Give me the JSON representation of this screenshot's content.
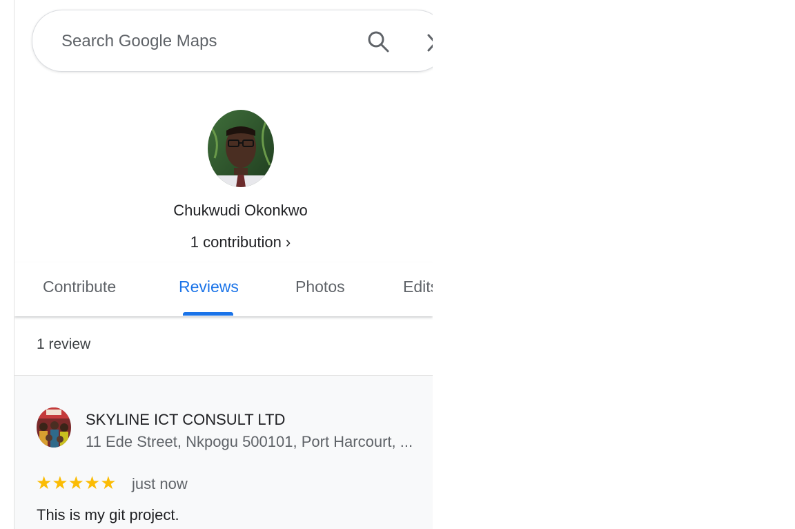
{
  "search": {
    "placeholder": "Search Google Maps",
    "search_icon": "search-icon",
    "close_icon": "close-icon"
  },
  "profile": {
    "name": "Chukwudi Okonkwo",
    "contributions": "1 contribution ›"
  },
  "tabs": [
    {
      "label": "Contribute",
      "active": false
    },
    {
      "label": "Reviews",
      "active": true
    },
    {
      "label": "Photos",
      "active": false
    },
    {
      "label": "Edits",
      "active": false
    }
  ],
  "reviews": {
    "count_label": "1 review",
    "items": [
      {
        "business_name": "SKYLINE ICT CONSULT LTD",
        "address": "11 Ede Street, Nkpogu 500101, Port Harcourt, ...",
        "rating": 5,
        "stars": "★★★★★",
        "time": "just now",
        "text": "This is my git project."
      }
    ]
  },
  "colors": {
    "accent": "#1a73e8",
    "star": "#fbbc04",
    "card_bg": "#f8f9fa"
  }
}
